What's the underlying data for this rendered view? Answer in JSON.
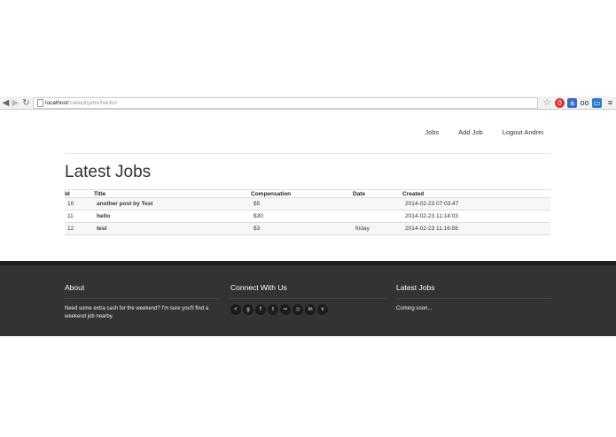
{
  "browser": {
    "url_host": "localhost",
    "url_path": "/cakephp/mchacks/"
  },
  "nav": {
    "jobs": "Jobs",
    "add_job": "Add Job",
    "logout": "Logout Andrei"
  },
  "page_title": "Latest Jobs",
  "table": {
    "headers": [
      "Id",
      "Title",
      "Compensation",
      "Date",
      "Created"
    ],
    "rows": [
      {
        "id": "10",
        "title": "another post by Test",
        "compensation": "$5",
        "date": "",
        "created": "2014-02-23 07:03:47"
      },
      {
        "id": "11",
        "title": "hello",
        "compensation": "$30",
        "date": "",
        "created": "2014-02-23 11:14:03"
      },
      {
        "id": "12",
        "title": "test",
        "compensation": "$3",
        "date": "friday",
        "created": "2014-02-23 11:16:56"
      }
    ]
  },
  "footer": {
    "about_title": "About",
    "about_text": "Need some extra cash for the weekend? I'm sure you'll find a weekend job nearby.",
    "connect_title": "Connect With Us",
    "social": [
      {
        "name": "share-icon",
        "glyph": "<"
      },
      {
        "name": "google-plus-icon",
        "glyph": "g"
      },
      {
        "name": "facebook-icon",
        "glyph": "f"
      },
      {
        "name": "twitter-icon",
        "glyph": "t"
      },
      {
        "name": "flickr-icon",
        "glyph": "••"
      },
      {
        "name": "dribbble-icon",
        "glyph": "◎"
      },
      {
        "name": "linkedin-icon",
        "glyph": "in"
      },
      {
        "name": "vimeo-icon",
        "glyph": "v"
      }
    ],
    "latest_title": "Latest Jobs",
    "latest_text": "Coming soon..."
  },
  "colors": {
    "footer_bg": "#333333",
    "footer_top": "#1f1f1f",
    "row_stripe": "#f7f7f7"
  }
}
